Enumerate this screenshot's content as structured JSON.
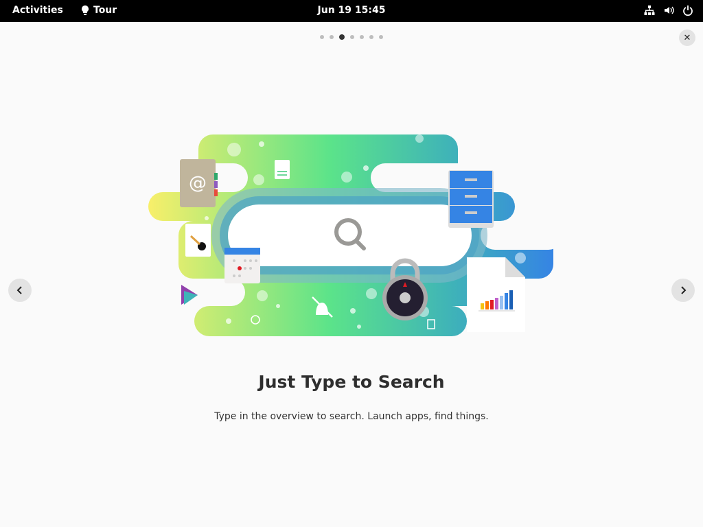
{
  "topbar": {
    "activities": "Activities",
    "app_name": "Tour",
    "clock": "Jun 19  15:45",
    "icons": [
      "network-icon",
      "volume-icon",
      "power-icon"
    ]
  },
  "pager": {
    "total": 7,
    "current": 3
  },
  "page": {
    "title": "Just Type to Search",
    "description": "Type in the overview to search. Launch apps, find things."
  },
  "colors": {
    "accent": "#3584e4",
    "yellow": "#f6f06a",
    "green": "#57e389",
    "teal": "#3fafba"
  }
}
